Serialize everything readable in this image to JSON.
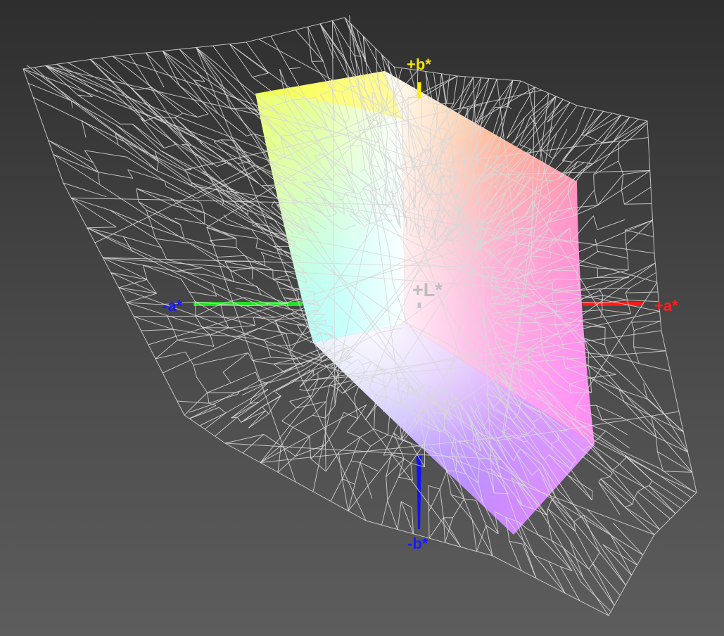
{
  "axes": {
    "plus_a": {
      "label": "+a*",
      "color": "#ff2020"
    },
    "minus_a": {
      "label": "-a*",
      "color": "#1a1aff"
    },
    "plus_b": {
      "label": "+b*",
      "color": "#f5e400"
    },
    "minus_b": {
      "label": "-b*",
      "color": "#1a1aff"
    },
    "plus_L": {
      "label": "+L*",
      "color": "#bdbdbd"
    }
  },
  "colors": {
    "background_top": "#2e2e2e",
    "background_bottom": "#5d5d5d",
    "wireframe": "#d8d8d8",
    "green_axis": "#22e022",
    "red_axis": "#ff1a1a",
    "blue_axis": "#1212ff",
    "yellow_axis": "#ffef00"
  }
}
